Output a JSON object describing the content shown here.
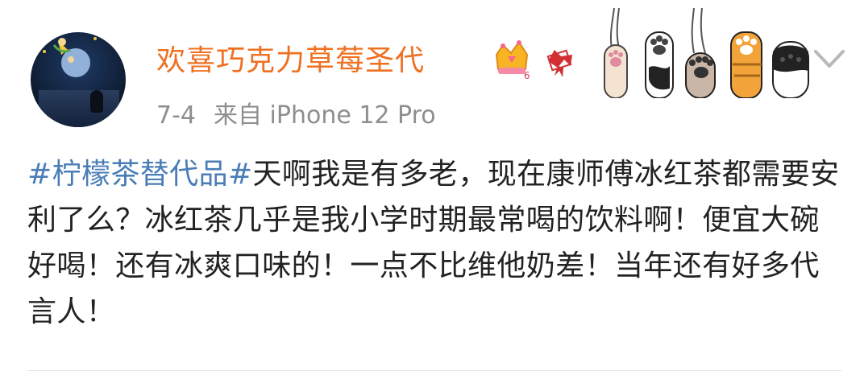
{
  "user": {
    "name": "欢喜巧克力草莓圣代",
    "avatar_icon": "little-prince-avatar",
    "badges": [
      "crown-vip-icon",
      "ribbon-envelope-icon"
    ],
    "decoration_icons": [
      "cat-paw-icon",
      "cat-paw-icon",
      "cat-paw-icon",
      "cat-paw-icon",
      "cat-paw-icon"
    ]
  },
  "meta": {
    "date": "7-4",
    "source": "来自 iPhone 12 Pro"
  },
  "post": {
    "hashtag": "#柠檬茶替代品#",
    "body": "天啊我是有多老，现在康师傅冰红茶都需要安利了么？冰红茶几乎是我小学时期最常喝的饮料啊！便宜大碗好喝！还有冰爽口味的！一点不比维他奶差！当年还有好多代言人！"
  },
  "colors": {
    "username": "#ef7021",
    "hashtag": "#4a7db6",
    "meta": "#8e8e8e",
    "text": "#222222"
  }
}
